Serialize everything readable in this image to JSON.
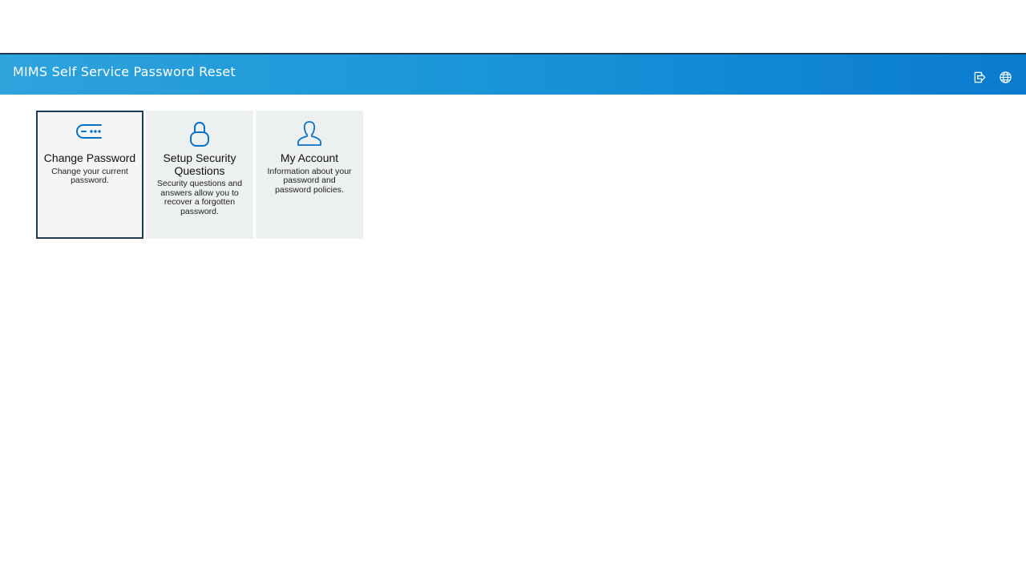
{
  "header": {
    "title": "MIMS Self Service Password Reset",
    "background_color": "#1b96d8",
    "actions": [
      {
        "name": "sign-out-icon"
      },
      {
        "name": "globe-icon"
      }
    ]
  },
  "tiles": [
    {
      "title": "Change Password",
      "description": "Change your current password.",
      "icon": "password-dots-icon",
      "selected": true
    },
    {
      "title": "Setup Security Questions",
      "description": "Security questions and answers allow you to recover a forgotten password.",
      "icon": "lock-icon",
      "selected": false
    },
    {
      "title": "My Account",
      "description": "Information about your password and password policies.",
      "icon": "user-icon",
      "selected": false
    }
  ],
  "colors": {
    "accent": "#0a72c4",
    "tile_background": "#ecf0f1",
    "selected_border": "#1e3a52"
  }
}
